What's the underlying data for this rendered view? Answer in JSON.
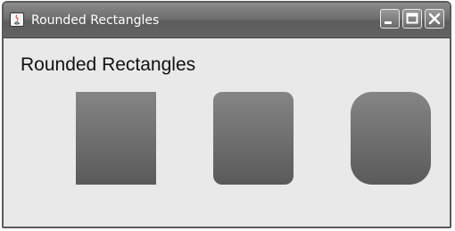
{
  "window": {
    "title": "Rounded Rectangles",
    "controls": {
      "minimize": "minimize-icon",
      "maximize": "maximize-icon",
      "close": "close-icon"
    }
  },
  "content": {
    "heading": "Rounded Rectangles",
    "shapes": [
      {
        "name": "square-corners",
        "fill_top": "#858585",
        "fill_bottom": "#5a5a5a"
      },
      {
        "name": "slightly-rounded-corners",
        "fill_top": "#858585",
        "fill_bottom": "#5a5a5a"
      },
      {
        "name": "more-rounded-corners",
        "fill_top": "#858585",
        "fill_bottom": "#5a5a5a"
      }
    ]
  },
  "colors": {
    "titlebar": "#6f6f6f",
    "title_text": "#ffffff",
    "background": "#e9e9e9",
    "shape": "#6e6e6e"
  }
}
